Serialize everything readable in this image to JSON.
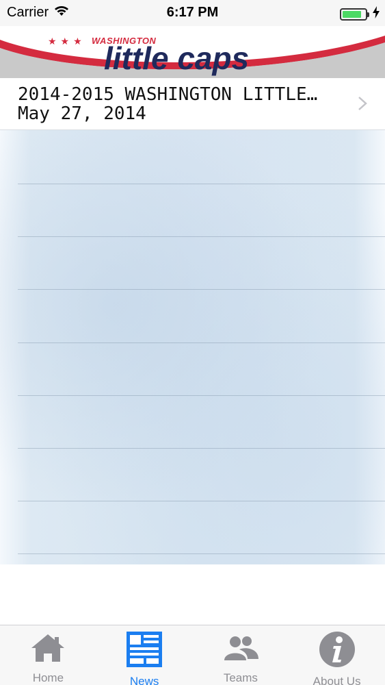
{
  "status_bar": {
    "carrier": "Carrier",
    "time": "6:17 PM",
    "battery_level": 0.85,
    "battery_color": "#4cd964"
  },
  "banner": {
    "stars": "★★★",
    "city": "WASHINGTON",
    "title": "little caps",
    "colors": {
      "red": "#d42b3f",
      "navy": "#1f2a5c"
    }
  },
  "news": {
    "items": [
      {
        "title": "2014-2015 WASHINGTON LITTLE…",
        "date": "May 27, 2014"
      }
    ]
  },
  "tab_bar": {
    "accent": "#1b7ef0",
    "tabs": [
      {
        "label": "Home",
        "icon": "home-icon",
        "active": false
      },
      {
        "label": "News",
        "icon": "news-icon",
        "active": true
      },
      {
        "label": "Teams",
        "icon": "teams-icon",
        "active": false
      },
      {
        "label": "About Us",
        "icon": "about-icon",
        "active": false
      }
    ]
  }
}
